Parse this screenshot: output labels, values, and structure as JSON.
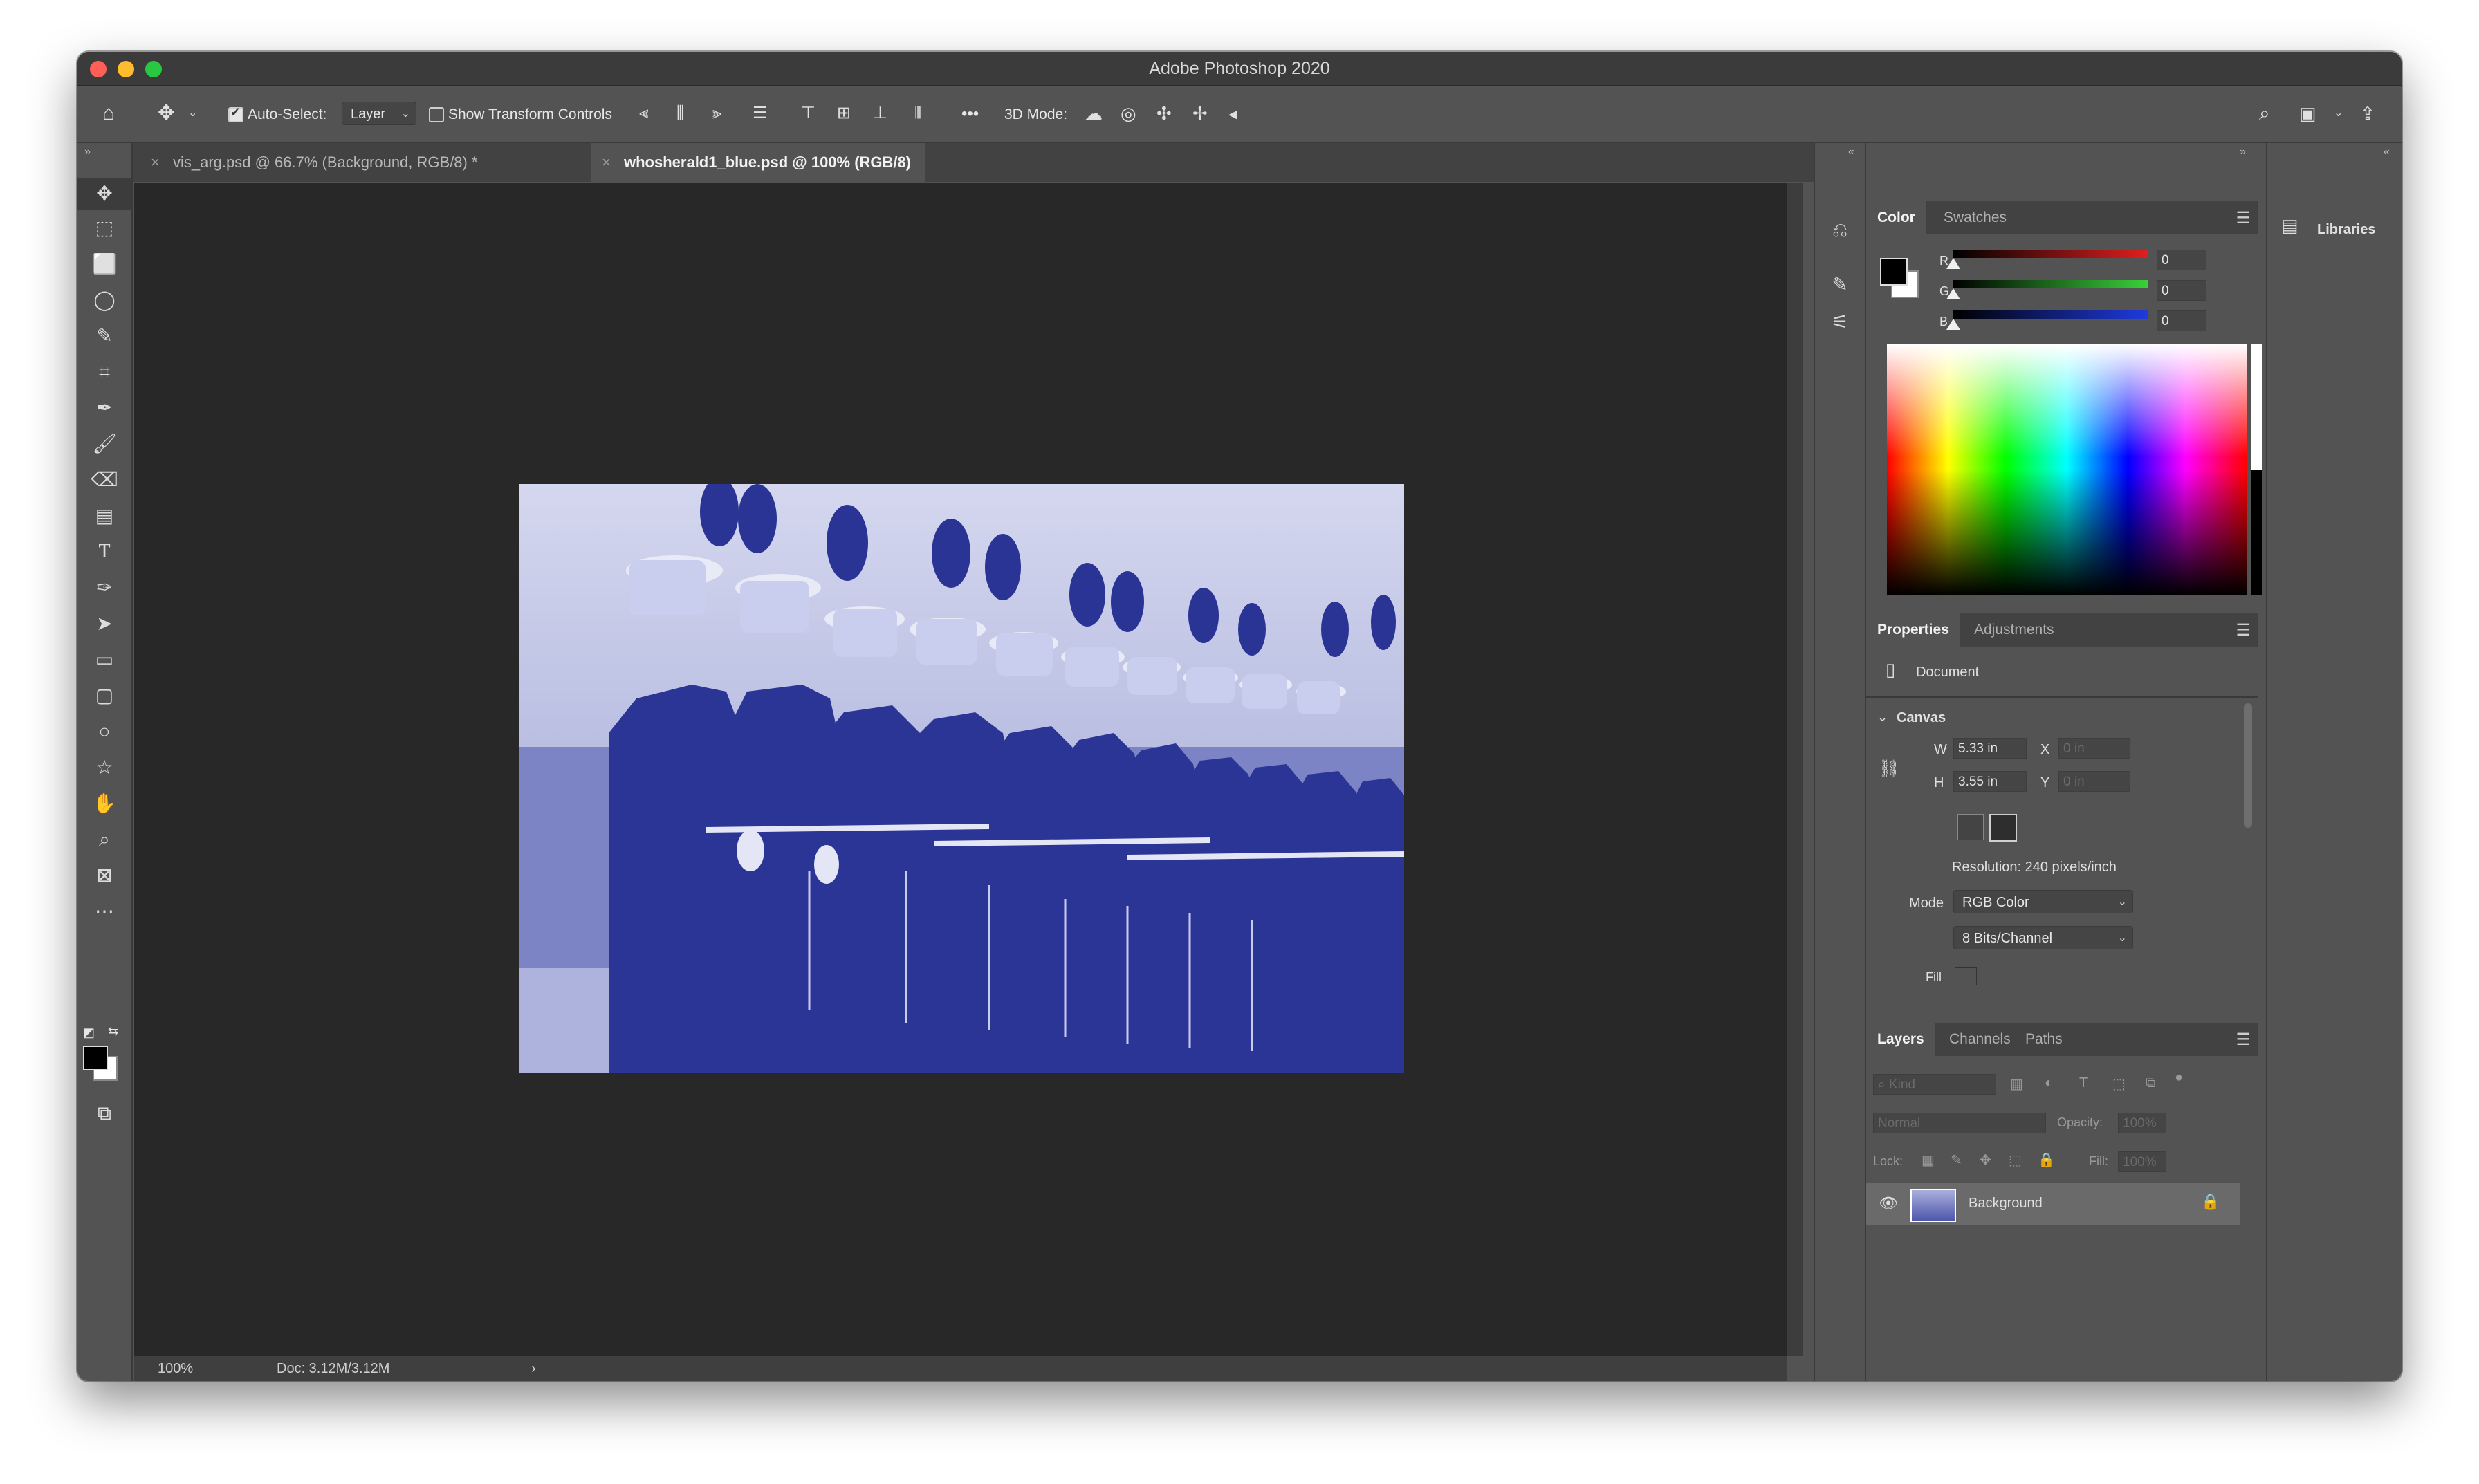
{
  "app": {
    "window_title": "Adobe Photoshop 2020"
  },
  "options_bar": {
    "auto_select_label": "Auto-Select:",
    "auto_select_checked": true,
    "auto_select_value": "Layer",
    "show_transform_label": "Show Transform Controls",
    "show_transform_checked": false,
    "more_label": "•••",
    "mode_3d_label": "3D Mode:"
  },
  "tabs": [
    {
      "label": "vis_arg.psd @ 66.7% (Background, RGB/8) *",
      "active": false
    },
    {
      "label": "whosherald1_blue.psd @ 100% (RGB/8)",
      "active": true
    }
  ],
  "status_bar": {
    "zoom": "100%",
    "doc_info": "Doc: 3.12M/3.12M",
    "arrow": "›"
  },
  "color_panel": {
    "tabs": [
      "Color",
      "Swatches"
    ],
    "channels": [
      {
        "label": "R",
        "value": "0",
        "color": "#e01f1f"
      },
      {
        "label": "G",
        "value": "0",
        "color": "#3ad13a"
      },
      {
        "label": "B",
        "value": "0",
        "color": "#1f3ae0"
      }
    ]
  },
  "properties_panel": {
    "tabs": [
      "Properties",
      "Adjustments"
    ],
    "doc_label": "Document",
    "canvas_label": "Canvas",
    "w_label": "W",
    "w_value": "5.33 in",
    "h_label": "H",
    "h_value": "3.55 in",
    "x_label": "X",
    "x_placeholder": "0 in",
    "y_label": "Y",
    "y_placeholder": "0 in",
    "resolution": "Resolution: 240 pixels/inch",
    "mode_label": "Mode",
    "mode_value": "RGB Color",
    "bits_value": "8 Bits/Channel",
    "fill_label": "Fill"
  },
  "layers_panel": {
    "tabs": [
      "Layers",
      "Channels",
      "Paths"
    ],
    "kind_placeholder": "Kind",
    "blend_mode": "Normal",
    "opacity_label": "Opacity:",
    "opacity_value": "100%",
    "lock_label": "Lock:",
    "fill_label": "Fill:",
    "fill_value": "100%",
    "layers": [
      {
        "name": "Background",
        "visible": true,
        "locked": true
      }
    ]
  },
  "libraries_panel": {
    "label": "Libraries"
  },
  "colors": {
    "duotone_blue": "#2e3a9c",
    "canvas_bg": "#282828",
    "chrome": "#535353"
  }
}
